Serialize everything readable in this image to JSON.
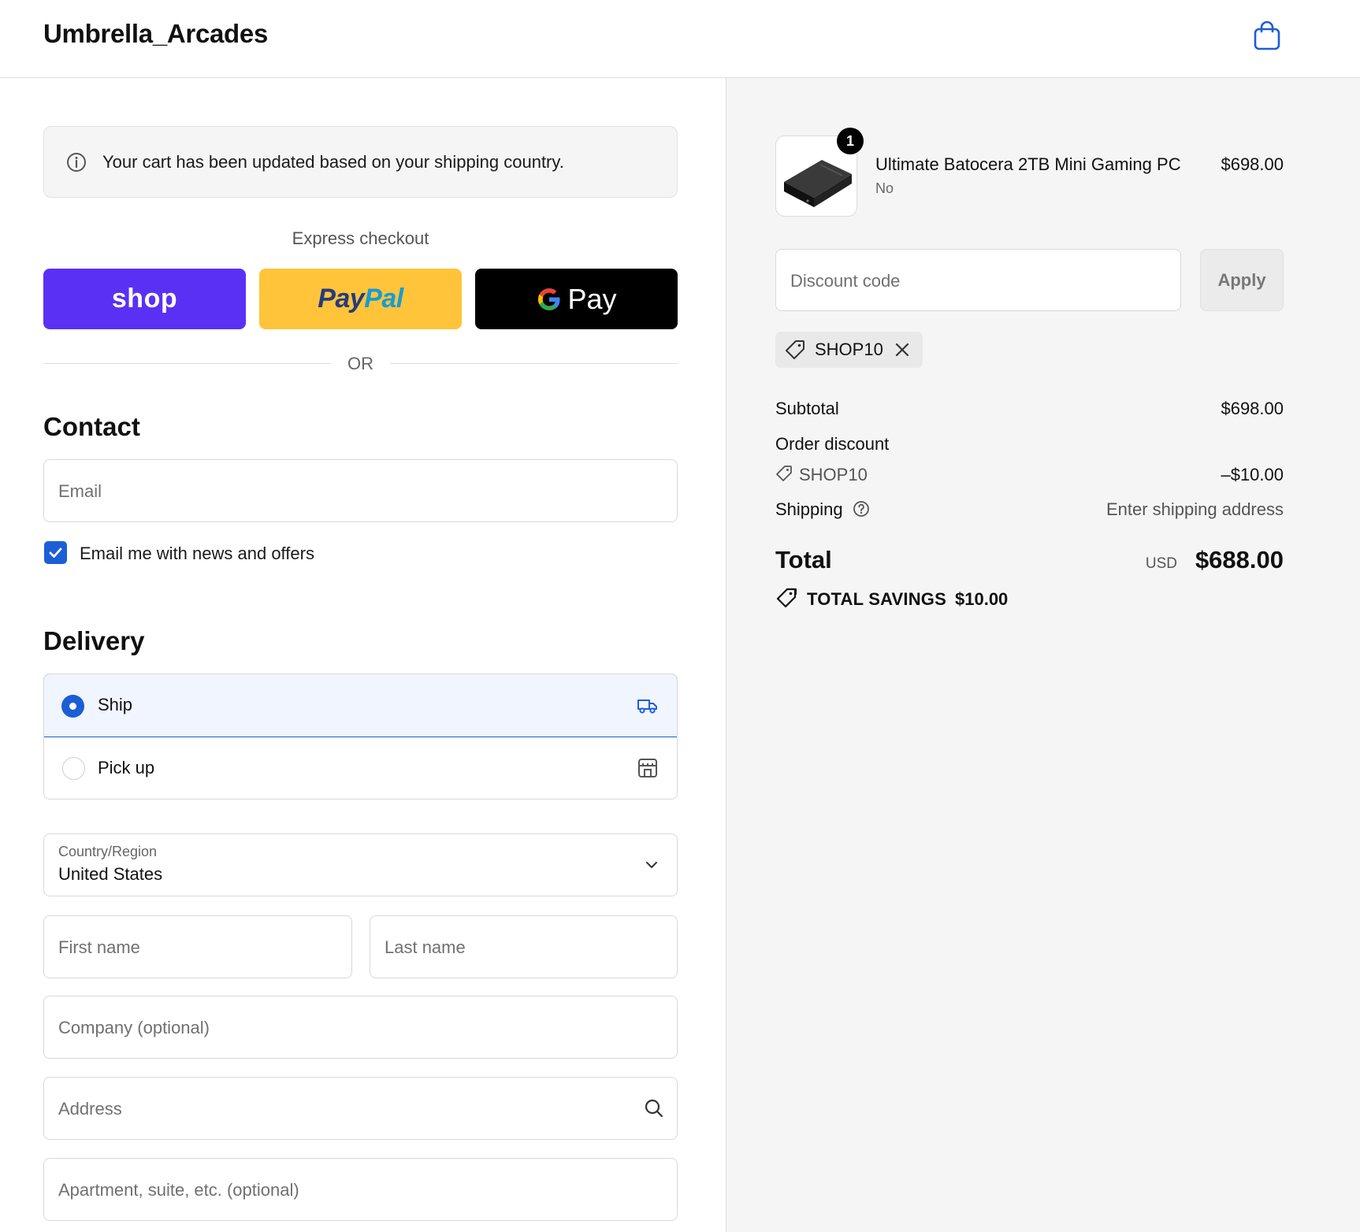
{
  "header": {
    "brand": "Umbrella_Arcades",
    "cart_icon": "shopping-bag-icon"
  },
  "notice": {
    "text": "Your cart has been updated based on your shipping country.",
    "icon": "info-icon"
  },
  "express": {
    "title": "Express checkout",
    "shop_label": "shop",
    "paypal_a": "Pay",
    "paypal_b": "Pal",
    "gpay_label": "Pay",
    "colors": {
      "shop": "#5a31f4",
      "paypal": "#ffc439",
      "gpay": "#000000"
    }
  },
  "or_text": "OR",
  "contact": {
    "title": "Contact",
    "email_placeholder": "Email",
    "newsletter_label": "Email me with news and offers",
    "newsletter_checked": true
  },
  "delivery": {
    "title": "Delivery",
    "options": [
      {
        "label": "Ship",
        "selected": true,
        "icon": "truck-icon"
      },
      {
        "label": "Pick up",
        "selected": false,
        "icon": "store-icon"
      }
    ],
    "country_label": "Country/Region",
    "country_value": "United States",
    "first_name_placeholder": "First name",
    "last_name_placeholder": "Last name",
    "company_placeholder": "Company (optional)",
    "address_placeholder": "Address",
    "apartment_placeholder": "Apartment, suite, etc. (optional)"
  },
  "summary": {
    "product": {
      "name": "Ultimate Batocera 2TB Mini Gaming PC",
      "variant": "No",
      "price": "$698.00",
      "quantity": "1"
    },
    "discount_placeholder": "Discount code",
    "apply_label": "Apply",
    "applied_code": "SHOP10",
    "subtotal_label": "Subtotal",
    "subtotal_value": "$698.00",
    "order_discount_label": "Order discount",
    "discount_code": "SHOP10",
    "discount_value": "–$10.00",
    "shipping_label": "Shipping",
    "shipping_value": "Enter shipping address",
    "total_label": "Total",
    "currency": "USD",
    "total_value": "$688.00",
    "savings_label": "TOTAL SAVINGS",
    "savings_value": "$10.00",
    "accent_color": "#1c5ed6"
  }
}
